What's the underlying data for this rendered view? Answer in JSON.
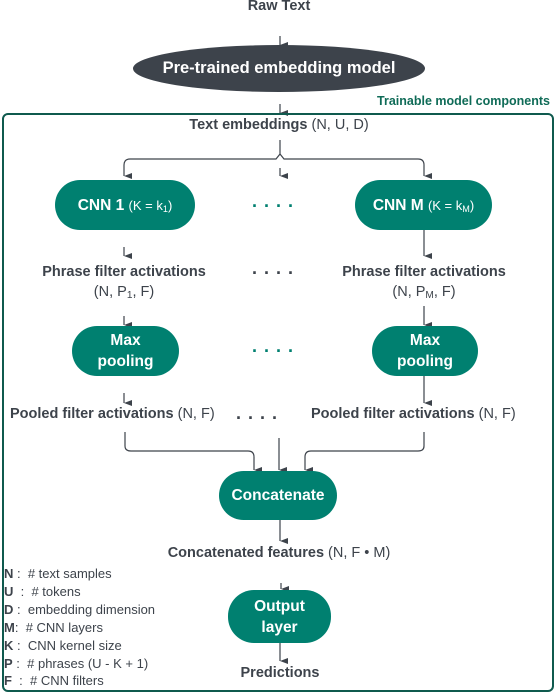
{
  "diagram": {
    "title_top": "Raw Text",
    "embedding_model": "Pre-trained embedding model",
    "container_label": "Trainable model components",
    "text_embeddings": {
      "label": "Text embeddings",
      "shape": "(N, U, D)"
    },
    "cnn_left": {
      "name": "CNN 1",
      "param_prefix": "(K = k",
      "param_sub": "1",
      "param_suffix": ")"
    },
    "cnn_right": {
      "name": "CNN M",
      "param_prefix": "(K = k",
      "param_sub": "M",
      "param_suffix": ")"
    },
    "ellipsis": "....",
    "phrase_left": {
      "label": "Phrase filter activations",
      "shape_prefix": "(N, P",
      "shape_sub": "1",
      "shape_suffix": ", F)"
    },
    "phrase_right": {
      "label": "Phrase filter activations",
      "shape_prefix": "(N, P",
      "shape_sub": "M",
      "shape_suffix": ", F)"
    },
    "pool_left": {
      "line1": "Max",
      "line2": "pooling"
    },
    "pool_right": {
      "line1": "Max",
      "line2": "pooling"
    },
    "pooled_left": {
      "label": "Pooled filter activations",
      "shape": "(N, F)"
    },
    "pooled_right": {
      "label": "Pooled filter activations",
      "shape": "(N, F)"
    },
    "concatenate": "Concatenate",
    "concat_features": {
      "label": "Concatenated features",
      "shape": "(N, F • M)"
    },
    "output_layer": {
      "line1": "Output",
      "line2": "layer"
    },
    "predictions": "Predictions",
    "legend": [
      {
        "key": "N",
        "sep": " :  ",
        "desc": "# text samples"
      },
      {
        "key": "U",
        "sep": "  :  ",
        "desc": "# tokens"
      },
      {
        "key": "D",
        "sep": " :  ",
        "desc": "embedding dimension"
      },
      {
        "key": "M",
        "sep": ":  ",
        "desc": "# CNN layers"
      },
      {
        "key": "K",
        "sep": " :  ",
        "desc": "CNN kernel size"
      },
      {
        "key": "P",
        "sep": " :  ",
        "desc": "# phrases (U - K + 1)"
      },
      {
        "key": "F",
        "sep": "  :  ",
        "desc": "# CNN filters"
      }
    ],
    "colors": {
      "dark": "#3d434b",
      "teal": "#008070",
      "container_border": "#0f5a4e",
      "container_label": "#0f6b57"
    }
  }
}
